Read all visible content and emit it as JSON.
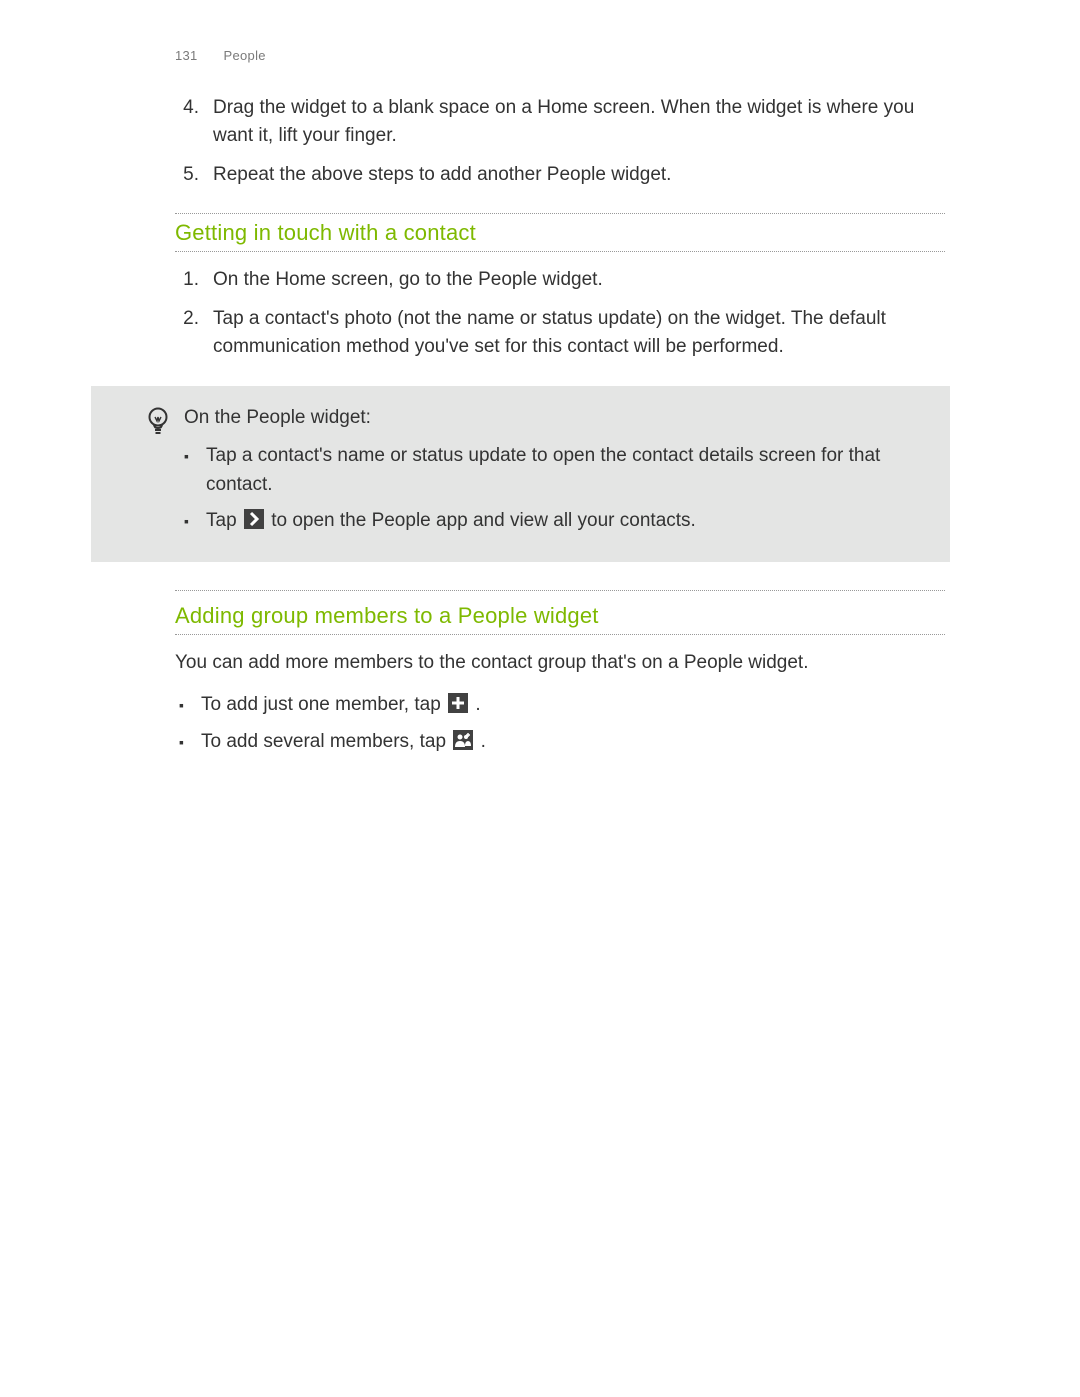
{
  "header": {
    "page_number": "131",
    "section": "People"
  },
  "top_steps": [
    {
      "n": "4.",
      "t": "Drag the widget to a blank space on a Home screen. When the widget is where you want it, lift your finger."
    },
    {
      "n": "5.",
      "t": "Repeat the above steps to add another People widget."
    }
  ],
  "section1": {
    "title": "Getting in touch with a contact",
    "steps": [
      {
        "n": "1.",
        "t": "On the Home screen, go to the People widget."
      },
      {
        "n": "2.",
        "t": "Tap a contact's photo (not the name or status update) on the widget. The default communication method you've set for this contact will be performed."
      }
    ]
  },
  "tip": {
    "intro": "On the People widget:",
    "items": {
      "b1": "Tap a contact's name or status update to open the contact details screen for that contact.",
      "b2_pre": "Tap ",
      "b2_post": " to open the People app and view all your contacts."
    }
  },
  "section2": {
    "title": "Adding group members to a People widget",
    "intro": "You can add more members to the contact group that's on a People widget.",
    "items": {
      "b1_pre": "To add just one member, tap ",
      "b1_post": ".",
      "b2_pre": "To add several members, tap ",
      "b2_post": "."
    }
  }
}
